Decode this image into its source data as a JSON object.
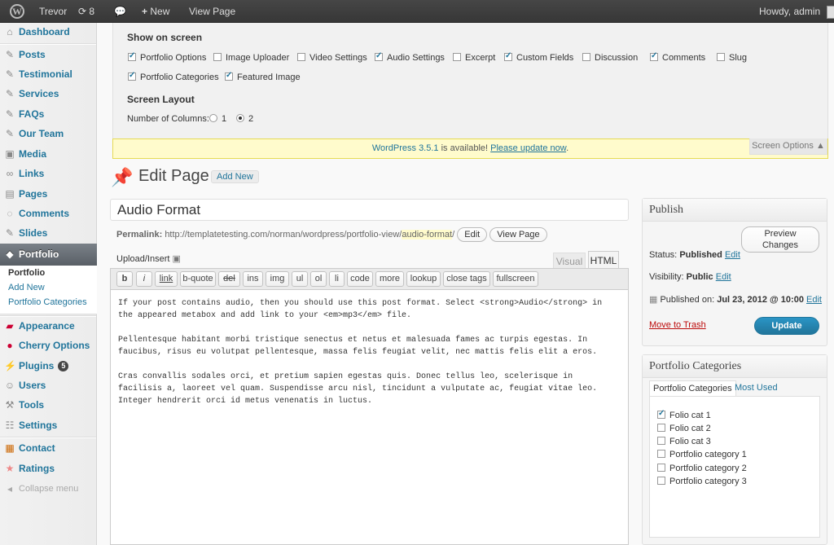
{
  "adminbar": {
    "site_name": "Trevor",
    "updates_count": "8",
    "new_label": "New",
    "view_page_label": "View Page",
    "howdy": "Howdy, admin"
  },
  "sidebar": {
    "items": [
      {
        "label": "Dashboard",
        "icon": "dashboard-icon"
      },
      {
        "label": "Posts",
        "icon": "pin-icon"
      },
      {
        "label": "Testimonial",
        "icon": "pin-icon"
      },
      {
        "label": "Services",
        "icon": "pin-icon"
      },
      {
        "label": "FAQs",
        "icon": "pin-icon"
      },
      {
        "label": "Our Team",
        "icon": "pin-icon"
      },
      {
        "label": "Media",
        "icon": "media-icon"
      },
      {
        "label": "Links",
        "icon": "link-icon"
      },
      {
        "label": "Pages",
        "icon": "pages-icon"
      },
      {
        "label": "Comments",
        "icon": "comment-icon"
      },
      {
        "label": "Slides",
        "icon": "pin-icon"
      },
      {
        "label": "Portfolio",
        "icon": "portfolio-icon"
      },
      {
        "label": "Appearance",
        "icon": "appearance-icon"
      },
      {
        "label": "Cherry Options",
        "icon": "cherry-icon"
      },
      {
        "label": "Plugins",
        "icon": "plugin-icon",
        "badge": "5"
      },
      {
        "label": "Users",
        "icon": "users-icon"
      },
      {
        "label": "Tools",
        "icon": "tools-icon"
      },
      {
        "label": "Settings",
        "icon": "settings-icon"
      },
      {
        "label": "Contact",
        "icon": "contact-icon"
      },
      {
        "label": "Ratings",
        "icon": "star-icon"
      }
    ],
    "submenu": [
      "Portfolio",
      "Add New",
      "Portfolio Categories"
    ],
    "collapse_label": "Collapse menu"
  },
  "screen_options": {
    "show_heading": "Show on screen",
    "checkboxes": [
      {
        "label": "Portfolio Options",
        "checked": true
      },
      {
        "label": "Image Uploader",
        "checked": false
      },
      {
        "label": "Video Settings",
        "checked": false
      },
      {
        "label": "Audio Settings",
        "checked": true
      },
      {
        "label": "Excerpt",
        "checked": false
      },
      {
        "label": "Custom Fields",
        "checked": true
      },
      {
        "label": "Discussion",
        "checked": false
      },
      {
        "label": "Comments",
        "checked": true
      },
      {
        "label": "Slug",
        "checked": false
      },
      {
        "label": "Portfolio Categories",
        "checked": true
      },
      {
        "label": "Featured Image",
        "checked": true
      }
    ],
    "layout_heading": "Screen Layout",
    "columns_label": "Number of Columns:",
    "col1": "1",
    "col2": "2",
    "tab_label": "Screen Options ▲"
  },
  "nag": {
    "version_link": "WordPress 3.5.1",
    "middle": " is available! ",
    "update_link": "Please update now",
    "end": "."
  },
  "page": {
    "title": "Edit Page",
    "add_new": "Add New",
    "post_title": "Audio Format",
    "permalink_label": "Permalink:",
    "permalink_url": "http://templatetesting.com/norman/wordpress/portfolio-view/",
    "permalink_slug": "audio-format",
    "permalink_end": "/",
    "edit_btn": "Edit",
    "view_btn": "View Page",
    "upload_label": "Upload/Insert",
    "tab_visual": "Visual",
    "tab_html": "HTML"
  },
  "quicktags": [
    "b",
    "i",
    "link",
    "b-quote",
    "del",
    "ins",
    "img",
    "ul",
    "ol",
    "li",
    "code",
    "more",
    "lookup",
    "close tags",
    "fullscreen"
  ],
  "editor": {
    "paragraphs": [
      "If your post contains audio, then you should use this post format. Select <strong>Audio</strong> in the appeared metabox and add link to your <em>mp3</em> file.",
      "Pellentesque habitant morbi tristique senectus et netus et malesuada fames ac turpis egestas. In faucibus, risus eu volutpat pellentesque, massa felis feugiat velit, nec mattis felis elit a eros.",
      "Cras convallis sodales orci, et pretium sapien egestas quis. Donec tellus leo, scelerisque in facilisis a, laoreet vel quam. Suspendisse arcu nisl, tincidunt a vulputate ac, feugiat vitae leo. Integer hendrerit orci id metus venenatis in luctus."
    ]
  },
  "publish": {
    "heading": "Publish",
    "preview_btn": "Preview Changes",
    "status_label": "Status:",
    "status_value": "Published",
    "visibility_label": "Visibility:",
    "visibility_value": "Public",
    "published_label": "Published on:",
    "published_value": "Jul 23, 2012 @ 10:00",
    "edit_link": "Edit",
    "trash": "Move to Trash",
    "update_btn": "Update"
  },
  "categories": {
    "heading": "Portfolio Categories",
    "tab_all": "Portfolio Categories",
    "tab_used": "Most Used",
    "items": [
      {
        "label": "Folio cat 1",
        "checked": true
      },
      {
        "label": "Folio cat 2",
        "checked": false
      },
      {
        "label": "Folio cat 3",
        "checked": false
      },
      {
        "label": "Portfolio category 1",
        "checked": false
      },
      {
        "label": "Portfolio category 2",
        "checked": false
      },
      {
        "label": "Portfolio category 3",
        "checked": false
      }
    ]
  }
}
